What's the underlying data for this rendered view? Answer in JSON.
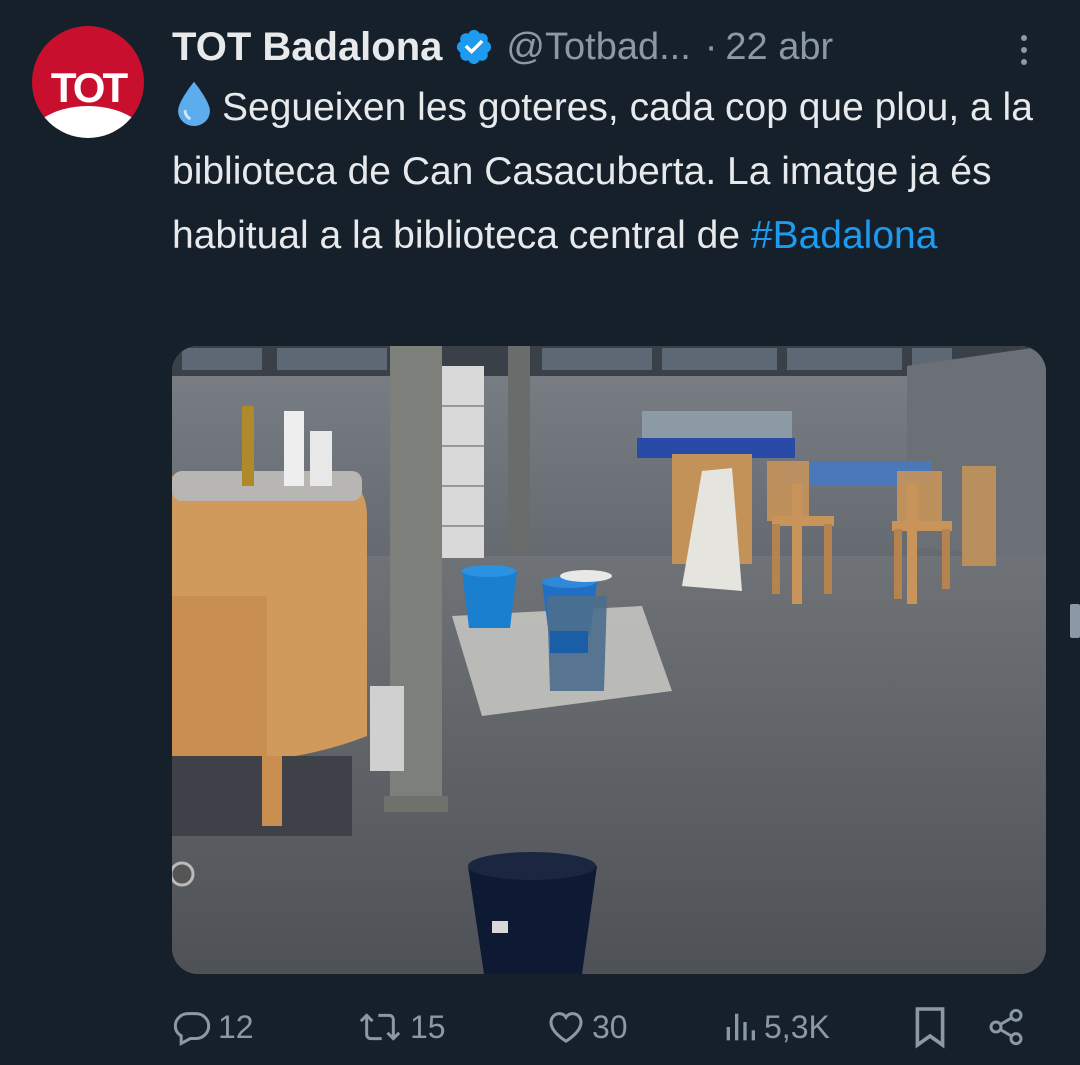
{
  "account": {
    "avatar_logo_text": "TOT",
    "name": "TOT Badalona",
    "handle": "@Totbad...",
    "separator": "·",
    "date": "22 abr"
  },
  "tweet": {
    "text": "Segueixen les goteres, cada cop que plou, a la biblioteca de Can Casacuberta. La imatge ja és habitual a la biblioteca central de ",
    "hashtag": "#Badalona",
    "emoji_icon": "droplet-icon"
  },
  "actions": {
    "replies": "12",
    "retweets": "15",
    "likes": "30",
    "views": "5,3K"
  },
  "colors": {
    "background": "#15202b",
    "text": "#e7e9ea",
    "secondary": "#8b98a5",
    "link": "#1d9bf0",
    "brand": "#c8102e"
  }
}
